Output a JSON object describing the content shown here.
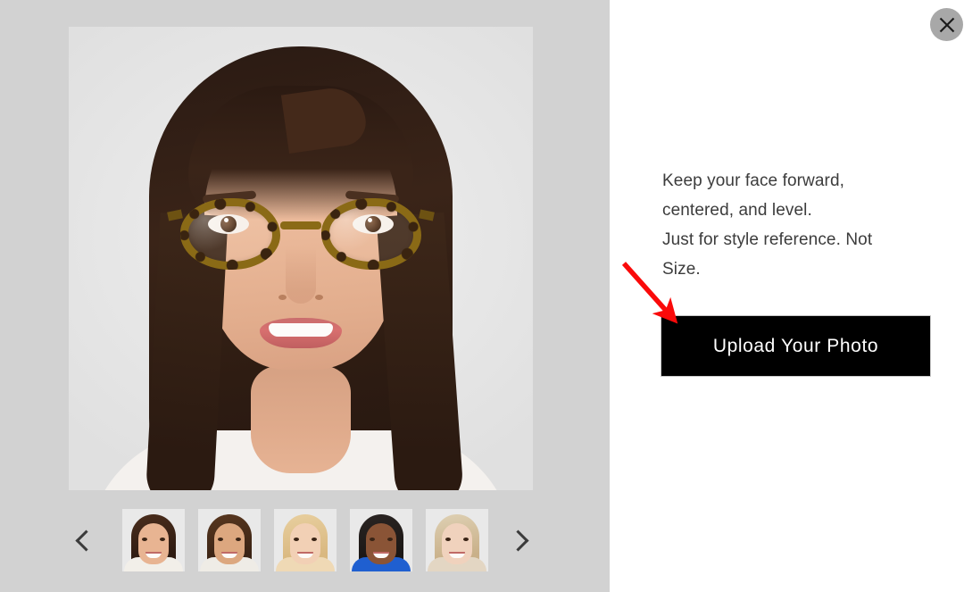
{
  "overlay": {
    "close_icon": "close-icon",
    "close_label": "Close"
  },
  "viewer": {
    "main_photo": {
      "alt": "Model wearing tortoiseshell eyeglasses, front facing portrait",
      "glasses_style": "tortoiseshell yellow-brown leopard pattern"
    },
    "carousel": {
      "prev_icon": "chevron-left-icon",
      "next_icon": "chevron-right-icon",
      "prev_label": "Previous models",
      "next_label": "Next models",
      "thumbnails": [
        {
          "alt": "Model 1 - brunette, medium skin tone",
          "selected": true,
          "hair": "#2e1b12",
          "hair2": "#4a2d1c",
          "skin": "#e8b492",
          "top": "#f2efe9"
        },
        {
          "alt": "Model 2 - dark brown hair, tan skin tone",
          "selected": false,
          "hair": "#3b2415",
          "hair2": "#58371f",
          "skin": "#dca77f",
          "top": "#efece6"
        },
        {
          "alt": "Model 3 - blonde, light skin tone",
          "selected": false,
          "hair": "#d9b880",
          "hair2": "#e8cf9f",
          "skin": "#f2d0b5",
          "top": "#efd9b5"
        },
        {
          "alt": "Model 4 - short black hair, deep skin tone",
          "selected": false,
          "hair": "#1b1715",
          "hair2": "#2a2422",
          "skin": "#8a5436",
          "top": "#1f5fd0"
        },
        {
          "alt": "Model 5 - light blonde, fair skin tone",
          "selected": false,
          "hair": "#c9b089",
          "hair2": "#ded0b3",
          "skin": "#f0d2bd",
          "top": "#e3d6c3"
        }
      ]
    }
  },
  "side_pane": {
    "instructions": [
      "Keep your face forward,",
      "centered, and level.",
      "Just for style reference. Not",
      "Size."
    ],
    "upload_button_label": "Upload Your Photo"
  },
  "annotation": {
    "arrow_name": "red-pointer-arrow",
    "arrow_color": "#FA0A0A",
    "points_to": "Upload Your Photo"
  },
  "colors": {
    "panel_background": "#d2d2d2",
    "stage_background": "#e8e8e8",
    "page_background": "#ffffff",
    "button_background": "#000000",
    "button_text": "#ffffff",
    "instruction_text": "#3c3c3c",
    "close_circle": "#a8a8a8",
    "accent_red": "#FA0A0A"
  }
}
